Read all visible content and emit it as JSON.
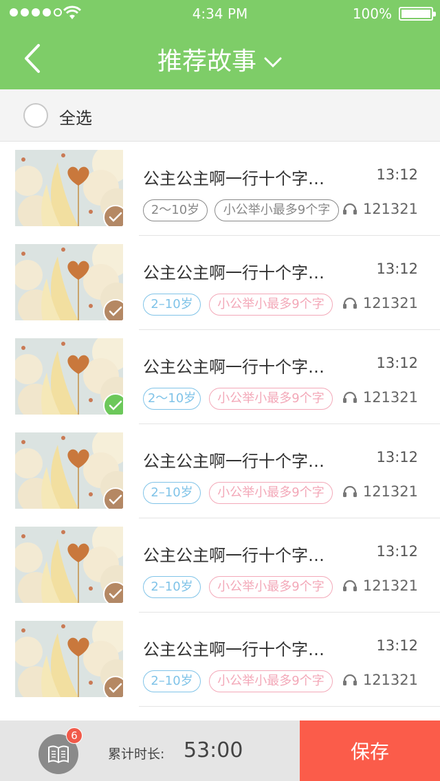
{
  "status_bar": {
    "time": "4:34 PM",
    "battery": "100%"
  },
  "header": {
    "title": "推荐故事"
  },
  "select_all": {
    "label": "全选"
  },
  "stories": [
    {
      "title": "公主公主啊一行十个字…",
      "duration": "13:12",
      "age": "2～10岁",
      "category": "小公举小最多9个字",
      "plays": "121321",
      "checked": false
    },
    {
      "title": "公主公主啊一行十个字…",
      "duration": "13:12",
      "age": "2–10岁",
      "category": "小公举小最多9个字",
      "plays": "121321",
      "checked": false
    },
    {
      "title": "公主公主啊一行十个字…",
      "duration": "13:12",
      "age": "2～10岁",
      "category": "小公举小最多9个字",
      "plays": "121321",
      "checked": true
    },
    {
      "title": "公主公主啊一行十个字…",
      "duration": "13:12",
      "age": "2–10岁",
      "category": "小公举小最多9个字",
      "plays": "121321",
      "checked": false
    },
    {
      "title": "公主公主啊一行十个字…",
      "duration": "13:12",
      "age": "2–10岁",
      "category": "小公举小最多9个字",
      "plays": "121321",
      "checked": false
    },
    {
      "title": "公主公主啊一行十个字…",
      "duration": "13:12",
      "age": "2–10岁",
      "category": "小公举小最多9个字",
      "plays": "121321",
      "checked": false
    }
  ],
  "bottom_bar": {
    "badge_count": "6",
    "total_label": "累计时长:",
    "total_value": "53:00",
    "save_label": "保存"
  },
  "colors": {
    "header": "#7ecd68",
    "save": "#fb5c4a",
    "check_on": "#6cc85a",
    "tag_blue": "#7fc3e8",
    "tag_pink": "#f3a8b8"
  }
}
